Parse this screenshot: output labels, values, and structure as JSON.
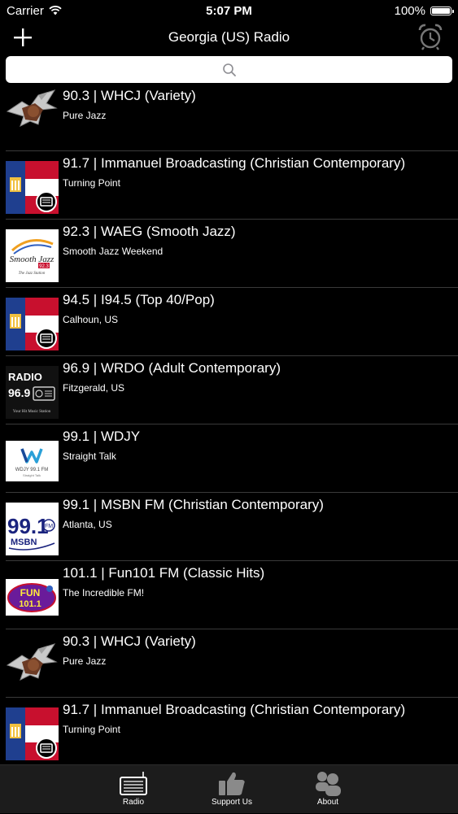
{
  "status": {
    "carrier": "Carrier",
    "time": "5:07 PM",
    "battery": "100%"
  },
  "header": {
    "title": "Georgia (US) Radio",
    "add_icon": "plus-icon",
    "alarm_icon": "alarm-clock-icon"
  },
  "search": {
    "placeholder": "",
    "icon": "search-icon"
  },
  "stations": [
    {
      "title": "90.3 | WHCJ (Variety)",
      "subtitle": "Pure Jazz",
      "logo": "whcj-eagle-logo"
    },
    {
      "title": "91.7 | Immanuel Broadcasting (Christian Contemporary)",
      "subtitle": "Turning Point",
      "logo": "georgia-flag-radio-logo"
    },
    {
      "title": "92.3 | WAEG (Smooth Jazz)",
      "subtitle": "Smooth Jazz Weekend",
      "logo": "smooth-jazz-logo"
    },
    {
      "title": "94.5 | I94.5 (Top 40/Pop)",
      "subtitle": "Calhoun, US",
      "logo": "georgia-flag-radio-logo"
    },
    {
      "title": "96.9 | WRDO (Adult Contemporary)",
      "subtitle": "Fitzgerald, US",
      "logo": "radio-969-logo"
    },
    {
      "title": "99.1 | WDJY",
      "subtitle": "Straight Talk",
      "logo": "wdjy-logo"
    },
    {
      "title": "99.1 | MSBN FM (Christian Contemporary)",
      "subtitle": "Atlanta, US",
      "logo": "msbn-991-logo"
    },
    {
      "title": "101.1 | Fun101 FM (Classic Hits)",
      "subtitle": "The Incredible FM!",
      "logo": "fun101-logo"
    },
    {
      "title": "90.3 | WHCJ (Variety)",
      "subtitle": "Pure Jazz",
      "logo": "whcj-eagle-logo"
    },
    {
      "title": "91.7 | Immanuel Broadcasting (Christian Contemporary)",
      "subtitle": "Turning Point",
      "logo": "georgia-flag-radio-logo"
    }
  ],
  "logo_text": {
    "smooth_jazz": "Smooth Jazz",
    "smooth_jazz_freq": "92.3",
    "smooth_jazz_sub": "The Jazz Station",
    "radio969_top": "RADIO",
    "radio969_freq": "96.9",
    "radio969_sub": "Your Hit Music Station",
    "wdjy_name": "WDJY 99.1 FM",
    "wdjy_sub": "Straight Talk",
    "msbn_freq": "99.1",
    "msbn_fm": "FM",
    "msbn_name": "MSBN",
    "fun_top": "FUN",
    "fun_freq": "101.1"
  },
  "tabs": [
    {
      "label": "Radio",
      "icon": "radio-icon"
    },
    {
      "label": "Support Us",
      "icon": "thumbs-up-icon"
    },
    {
      "label": "About",
      "icon": "people-icon"
    }
  ],
  "colors": {
    "background": "#000000",
    "tab_bar": "#1c1c1c",
    "separator": "#3a3a3a"
  }
}
